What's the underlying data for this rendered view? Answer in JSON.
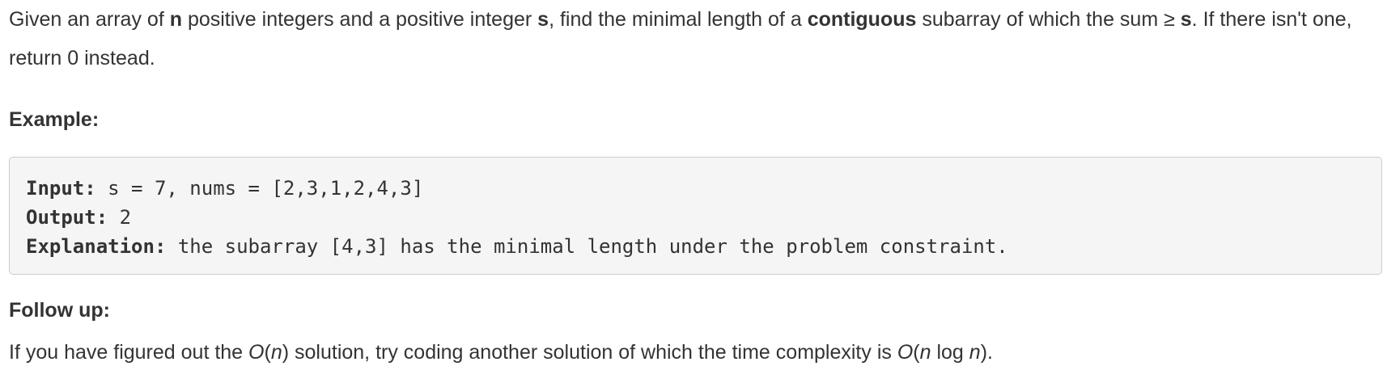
{
  "problem": {
    "intro_part1": "Given an array of ",
    "intro_n": "n",
    "intro_part2": " positive integers and a positive integer ",
    "intro_s": "s",
    "intro_part3": ", find the minimal length of a ",
    "intro_contiguous": "contiguous",
    "intro_part4": " subarray of which the sum ≥ ",
    "intro_s2": "s",
    "intro_part5": ". If there isn't one, return 0 instead."
  },
  "example": {
    "heading": "Example:",
    "input_label": "Input:",
    "input_value": " s = 7, nums = [2,3,1,2,4,3]",
    "output_label": "Output:",
    "output_value": " 2",
    "explanation_label": "Explanation:",
    "explanation_value": " the subarray [4,3] has the minimal length under the problem constraint."
  },
  "follow_up": {
    "heading": "Follow up:",
    "part1": "If you have figured out the ",
    "o1": "O",
    "paren1_open": "(",
    "n1": "n",
    "paren1_close": ")",
    "part2": " solution, try coding another solution of which the time complexity is ",
    "o2": "O",
    "paren2_open": "(",
    "n2": "n",
    "log": " log ",
    "n3": "n",
    "paren2_close": ").",
    "part3": ""
  }
}
